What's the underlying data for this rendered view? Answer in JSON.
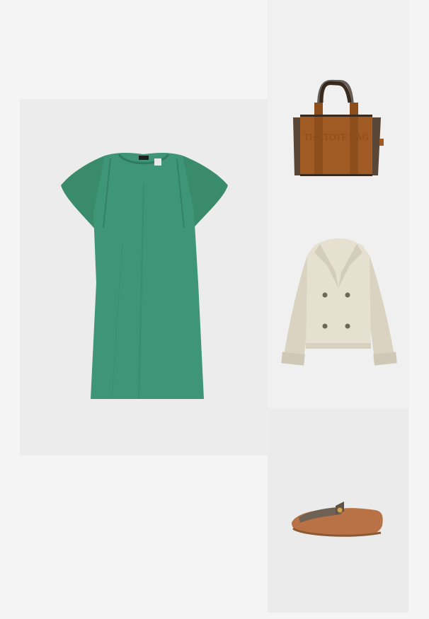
{
  "products": [
    {
      "id": "dress",
      "item": "green short-sleeve shift dress",
      "colors": {
        "main": "#3f9577",
        "shade": "#2f7a60"
      }
    },
    {
      "id": "bag",
      "item": "brown suede tote bag",
      "logo_text": "THE TOTE BAG",
      "colors": {
        "main": "#a05a24",
        "trim": "#3b2a1e"
      }
    },
    {
      "id": "coat",
      "item": "beige cropped trench jacket",
      "colors": {
        "main": "#e6e0d0",
        "shade": "#cfc8b6"
      }
    },
    {
      "id": "shoe",
      "item": "tan leather loafer",
      "colors": {
        "main": "#b97245",
        "detail": "#6f6254"
      }
    }
  ]
}
